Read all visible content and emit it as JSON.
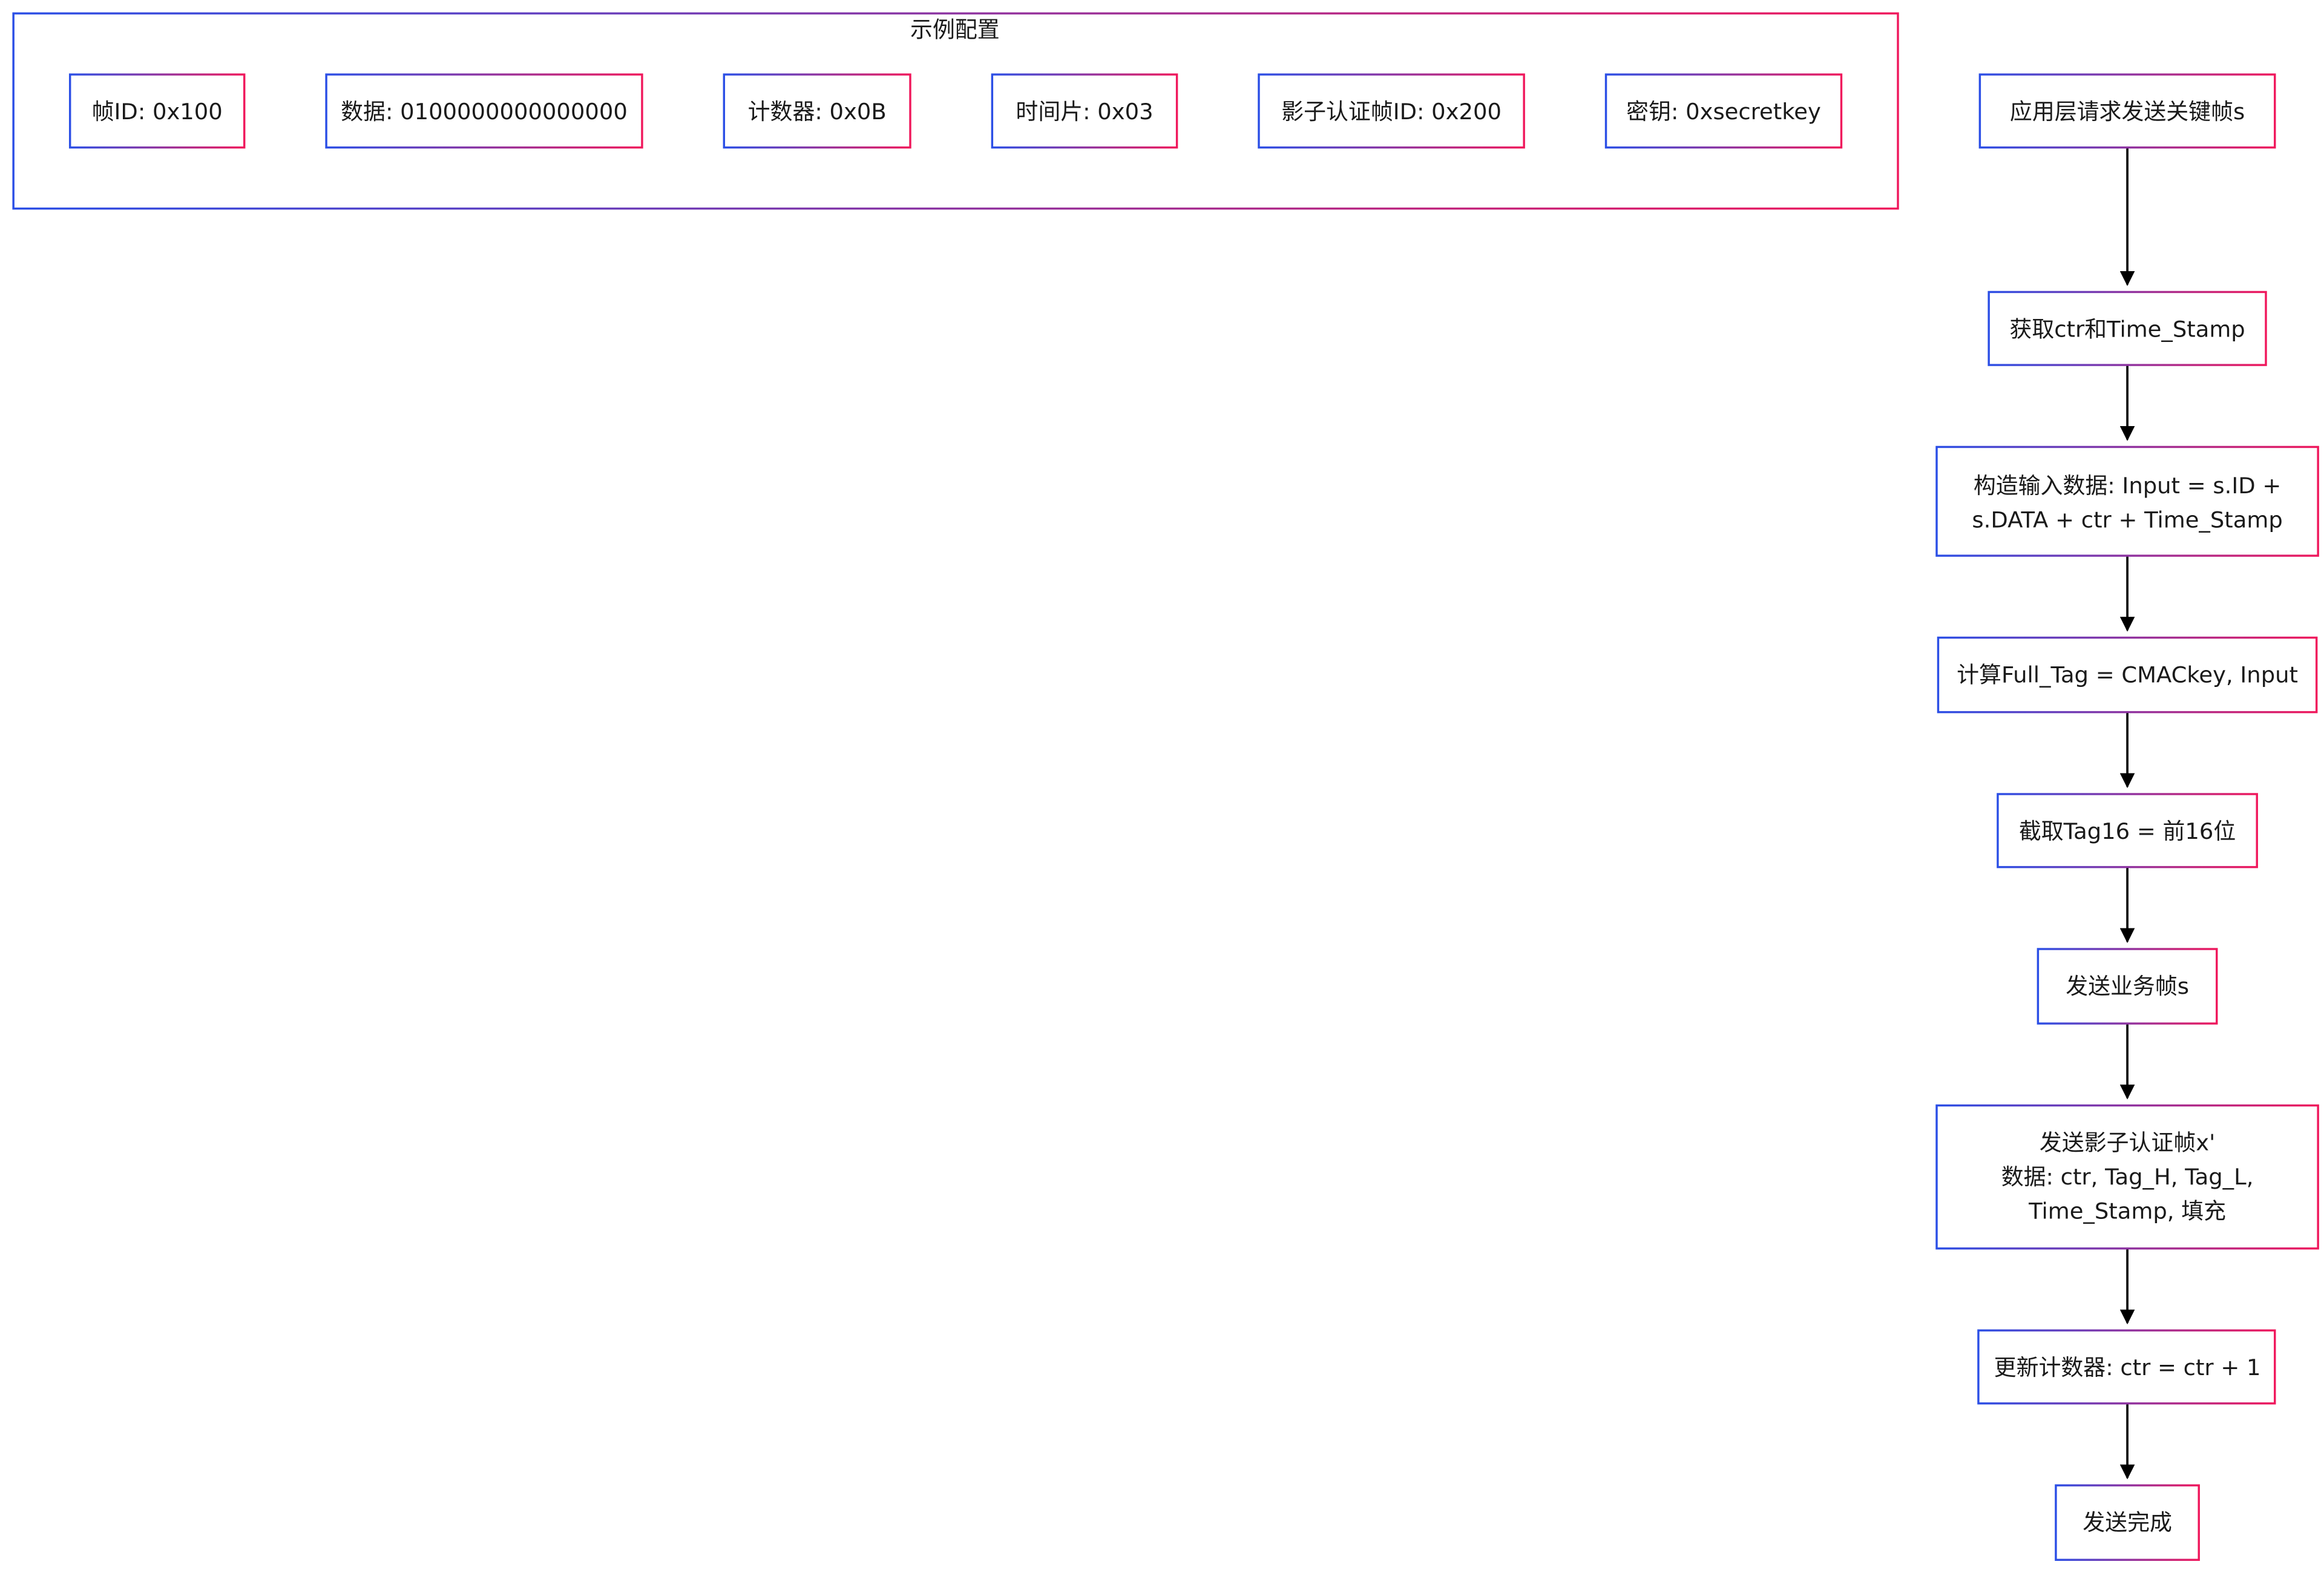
{
  "config_group": {
    "title": "示例配置",
    "items": [
      {
        "id": "frame-id",
        "label": "帧ID: 0x100"
      },
      {
        "id": "data",
        "label": "数据: 0100000000000000"
      },
      {
        "id": "counter",
        "label": "计数器: 0x0B"
      },
      {
        "id": "time-slice",
        "label": "时间片: 0x03"
      },
      {
        "id": "shadow-frame-id",
        "label": "影子认证帧ID: 0x200"
      },
      {
        "id": "key",
        "label": "密钥: 0xsecretkey"
      }
    ]
  },
  "flow": {
    "steps": [
      {
        "id": "request",
        "lines": [
          "应用层请求发送关键帧s"
        ]
      },
      {
        "id": "get-ctr",
        "lines": [
          "获取ctr和Time_Stamp"
        ]
      },
      {
        "id": "build-input",
        "lines": [
          "构造输入数据: Input = s.ID +",
          "s.DATA + ctr + Time_Stamp"
        ]
      },
      {
        "id": "compute-tag",
        "lines": [
          "计算Full_Tag = CMACkey, Input"
        ]
      },
      {
        "id": "truncate",
        "lines": [
          "截取Tag16 = 前16位"
        ]
      },
      {
        "id": "send-business",
        "lines": [
          "发送业务帧s"
        ]
      },
      {
        "id": "send-shadow",
        "lines": [
          "发送影子认证帧x'",
          "数据: ctr, Tag_H, Tag_L,",
          "Time_Stamp, 填充"
        ]
      },
      {
        "id": "update-counter",
        "lines": [
          "更新计数器: ctr = ctr + 1"
        ]
      },
      {
        "id": "done",
        "lines": [
          "发送完成"
        ]
      }
    ]
  },
  "colors": {
    "gradient_start": "#2b4fe6",
    "gradient_end": "#f0185c",
    "arrow": "#000000",
    "text": "#1a1a1a"
  }
}
